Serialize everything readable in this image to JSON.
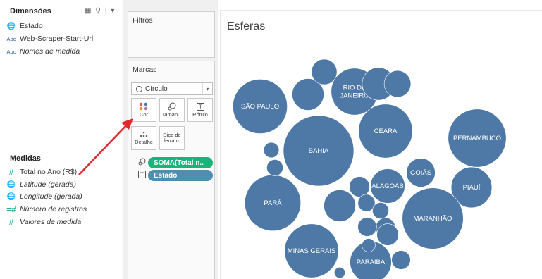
{
  "data_pane": {
    "dimensions_title": "Dimensões",
    "dimensions": [
      {
        "icon": "globe-icon",
        "label": "Estado",
        "italic": false
      },
      {
        "icon": "abc-icon",
        "label": "Web-Scraper-Start-Url",
        "italic": false
      },
      {
        "icon": "abc-icon",
        "label": "Nomes de medida",
        "italic": true
      }
    ],
    "measures_title": "Medidas",
    "measures": [
      {
        "icon": "hash-icon",
        "label": "Total no Ano (R$)",
        "italic": false
      },
      {
        "icon": "globe-icon",
        "label": "Latitude (gerada)",
        "italic": true
      },
      {
        "icon": "globe-icon",
        "label": "Longitude (gerada)",
        "italic": true
      },
      {
        "icon": "hash-icon",
        "label": "Número de registros",
        "italic": true
      },
      {
        "icon": "hash-icon",
        "label": "Valores de medida",
        "italic": true
      }
    ]
  },
  "shelves": {
    "filters_title": "Filtros",
    "marks_title": "Marcas",
    "mark_type": "Círculo",
    "buttons": {
      "color": "Cor",
      "size": "Taman...",
      "label": "Rótulo",
      "detail": "Detalhe",
      "tooltip": "Dica de ferram."
    },
    "pills": [
      {
        "label": "SOMA(Total n..",
        "color": "#1ab37a"
      },
      {
        "label": "Estado",
        "color": "#4e8fb0"
      }
    ]
  },
  "view": {
    "title": "Esferas",
    "bubble_color": "#4e79a7",
    "arrow_color": "#e0282e"
  },
  "chart_data": {
    "type": "bubble",
    "series": [
      {
        "name": "",
        "values": [
          {
            "label": "SÃO PAULO",
            "value": 100
          },
          {
            "label": "BAHIA",
            "value": 168
          },
          {
            "label": "RIO DE JANEIRO",
            "value": 74
          },
          {
            "label": "CEARÁ",
            "value": 98
          },
          {
            "label": "PERNAMBUCO",
            "value": 114
          },
          {
            "label": "GOIÁS",
            "value": 28
          },
          {
            "label": "ALAGOAS",
            "value": 40
          },
          {
            "label": "PIAUÍ",
            "value": 56
          },
          {
            "label": "PARÁ",
            "value": 106
          },
          {
            "label": "MARANHÃO",
            "value": 126
          },
          {
            "label": "MINAS GERAIS",
            "value": 98
          },
          {
            "label": "PARAÍBA",
            "value": 58
          },
          {
            "label": "",
            "value": 36
          },
          {
            "label": "",
            "value": 34
          },
          {
            "label": "",
            "value": 24
          },
          {
            "label": "",
            "value": 22
          },
          {
            "label": "",
            "value": 34
          },
          {
            "label": "",
            "value": 14
          },
          {
            "label": "",
            "value": 8
          },
          {
            "label": "",
            "value": 9
          },
          {
            "label": "",
            "value": 10
          },
          {
            "label": "",
            "value": 9
          },
          {
            "label": "",
            "value": 13
          },
          {
            "label": "",
            "value": 12
          },
          {
            "label": "",
            "value": 16
          },
          {
            "label": "",
            "value": 6
          },
          {
            "label": "",
            "value": 12
          },
          {
            "label": "",
            "value": 4
          }
        ]
      }
    ]
  }
}
